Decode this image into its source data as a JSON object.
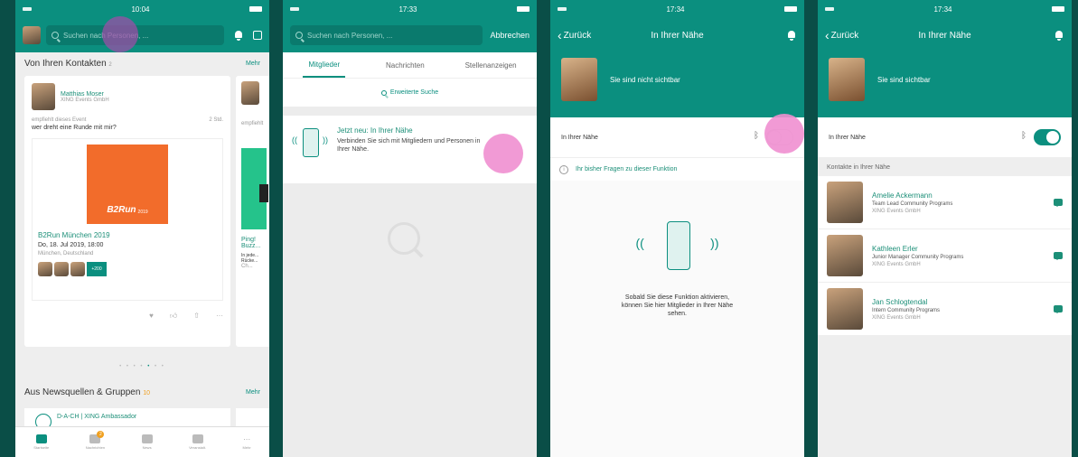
{
  "status": {
    "time1": "10:04",
    "time2": "17:33",
    "time3": "17:34",
    "time4": "17:34"
  },
  "screen1": {
    "search_placeholder": "Suchen nach Personen, ...",
    "contacts_section": "Von Ihren Kontakten",
    "contacts_count": "2",
    "more_label": "Mehr",
    "post": {
      "author": "Matthias Moser",
      "author_sub": "XING Events GmbH",
      "activity": "empfiehlt dieses Event",
      "age": "2 Std.",
      "text": "wer dreht eine Runde mit mir?",
      "event_brand": "B2Run",
      "event_year": "2019",
      "event_title": "B2Run München 2019",
      "event_date": "Do, 18. Jul 2019, 18:00",
      "event_location": "München, Deutschland",
      "attendees_more": "+200"
    },
    "side_card": {
      "activity": "empfiehlt",
      "title": "Ping! Buzz...",
      "text": "In jede... Rücke...",
      "sub": "Ch..."
    },
    "news_section": "Aus Newsquellen & Gruppen",
    "news_count": "10",
    "news_item": "D-A-CH | XING Ambassador",
    "tabs": [
      "Startseite",
      "Nachrichten",
      "News",
      "Veranstalt.",
      "Mehr"
    ],
    "tab_badge": "2"
  },
  "screen2": {
    "search_placeholder": "Suchen nach Personen, ...",
    "cancel_label": "Abbrechen",
    "tabs": [
      "Mitglieder",
      "Nachrichten",
      "Stellenanzeigen"
    ],
    "search_button": "Erweiterte Suche",
    "nearby_title": "Jetzt neu: In Ihrer Nähe",
    "nearby_text": "Verbinden Sie sich mit Mitgliedern und Personen in Ihrer Nähe."
  },
  "screen3": {
    "back_label": "Zurück",
    "title": "In Ihrer Nähe",
    "banner_text": "Sie sind nicht sichtbar",
    "toggle_label": "In Ihrer Nähe",
    "info_text": "Ihr bisher Fragen zu dieser Funktion",
    "empty_text": "Sobald Sie diese Funktion aktivieren, können Sie hier Mitglieder in Ihrer Nähe sehen."
  },
  "screen4": {
    "back_label": "Zurück",
    "title": "In Ihrer Nähe",
    "banner_text": "Sie sind sichtbar",
    "toggle_label": "In Ihrer Nähe",
    "list_header": "Kontakte in Ihrer Nähe",
    "contacts": [
      {
        "name": "Amelie Ackermann",
        "role": "Team Lead Community Programs",
        "company": "XING Events GmbH"
      },
      {
        "name": "Kathleen Erler",
        "role": "Junior Manager Community Programs",
        "company": "XING Events GmbH"
      },
      {
        "name": "Jan Schlogtendal",
        "role": "Intern Community Programs",
        "company": "XING Events GmbH"
      }
    ]
  },
  "colors": {
    "teal": "#0b8f7f",
    "dark_teal": "#0a4e47",
    "touch": "#ef8fd0",
    "accent": "#f0a020"
  }
}
